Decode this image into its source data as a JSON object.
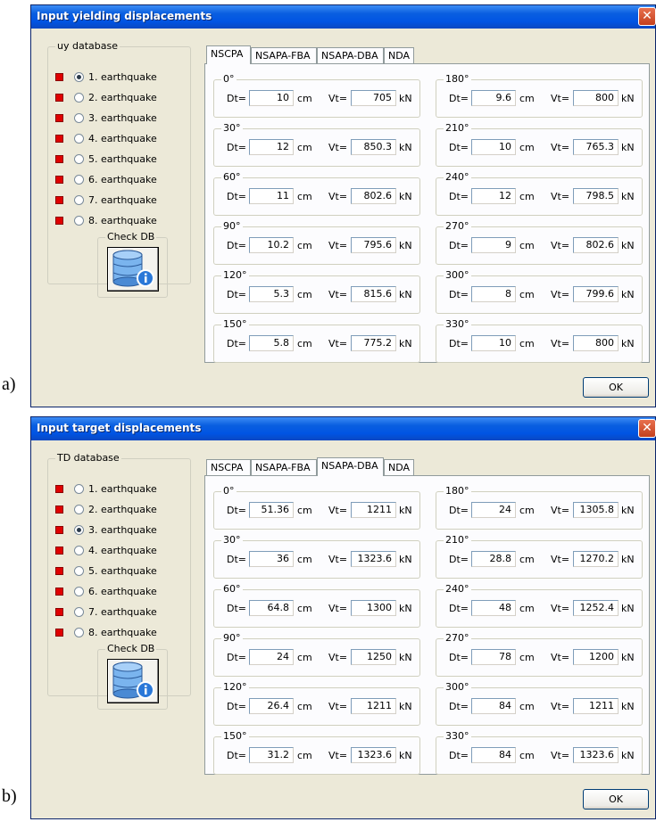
{
  "captions": [
    "a)",
    "b)"
  ],
  "common": {
    "dt_label": "Dt=",
    "vt_label": "Vt=",
    "dt_unit": "cm",
    "vt_unit": "kN",
    "radio_labels": [
      "1. earthquake",
      "2. earthquake",
      "3. earthquake",
      "4. earthquake",
      "5. earthquake",
      "6. earthquake",
      "7. earthquake",
      "8. earthquake"
    ],
    "tabs": [
      "NSCPA",
      "NSAPA-FBA",
      "NSAPA-DBA",
      "NDA"
    ],
    "check_db_label": "Check DB",
    "ok_label": "OK",
    "close_glyph": "✕",
    "icon": "database-info-icon",
    "accent_color": "#e00000"
  },
  "windows": [
    {
      "title": "Input yielding displacements",
      "db_label": "uy database",
      "selected_radio": 0,
      "active_tab": 0,
      "left_column": [
        {
          "angle": "0°",
          "dt": "10",
          "vt": "705"
        },
        {
          "angle": "30°",
          "dt": "12",
          "vt": "850.3"
        },
        {
          "angle": "60°",
          "dt": "11",
          "vt": "802.6"
        },
        {
          "angle": "90°",
          "dt": "10.2",
          "vt": "795.6"
        },
        {
          "angle": "120°",
          "dt": "5.3",
          "vt": "815.6"
        },
        {
          "angle": "150°",
          "dt": "5.8",
          "vt": "775.2"
        }
      ],
      "right_column": [
        {
          "angle": "180°",
          "dt": "9.6",
          "vt": "800"
        },
        {
          "angle": "210°",
          "dt": "10",
          "vt": "765.3"
        },
        {
          "angle": "240°",
          "dt": "12",
          "vt": "798.5"
        },
        {
          "angle": "270°",
          "dt": "9",
          "vt": "802.6"
        },
        {
          "angle": "300°",
          "dt": "8",
          "vt": "799.6"
        },
        {
          "angle": "330°",
          "dt": "10",
          "vt": "800"
        }
      ]
    },
    {
      "title": "Input target displacements",
      "db_label": "TD database",
      "selected_radio": 2,
      "active_tab": 2,
      "left_column": [
        {
          "angle": "0°",
          "dt": "51.36",
          "vt": "1211"
        },
        {
          "angle": "30°",
          "dt": "36",
          "vt": "1323.6"
        },
        {
          "angle": "60°",
          "dt": "64.8",
          "vt": "1300"
        },
        {
          "angle": "90°",
          "dt": "24",
          "vt": "1250"
        },
        {
          "angle": "120°",
          "dt": "26.4",
          "vt": "1211"
        },
        {
          "angle": "150°",
          "dt": "31.2",
          "vt": "1323.6"
        }
      ],
      "right_column": [
        {
          "angle": "180°",
          "dt": "24",
          "vt": "1305.8"
        },
        {
          "angle": "210°",
          "dt": "28.8",
          "vt": "1270.2"
        },
        {
          "angle": "240°",
          "dt": "48",
          "vt": "1252.4"
        },
        {
          "angle": "270°",
          "dt": "78",
          "vt": "1200"
        },
        {
          "angle": "300°",
          "dt": "84",
          "vt": "1211"
        },
        {
          "angle": "330°",
          "dt": "84",
          "vt": "1323.6"
        }
      ]
    }
  ]
}
